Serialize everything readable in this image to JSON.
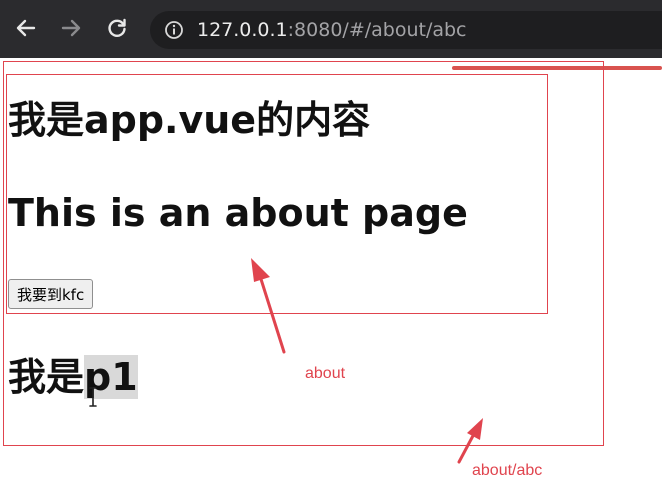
{
  "browser": {
    "url_host": "127.0.0.1",
    "url_rest": ":8080/#/about/abc"
  },
  "page": {
    "app_heading": "我是app.vue的内容",
    "about_heading": "This is an about page",
    "kfc_button_label": "我要到kfc",
    "p1_prefix": "我是",
    "p1_highlight": "p1"
  },
  "annotations": {
    "inner_label": "about",
    "outer_label": "about/abc",
    "color": "#e0444e"
  },
  "icons": [
    "back-arrow-icon",
    "forward-arrow-icon",
    "reload-icon",
    "info-icon",
    "text-cursor-icon",
    "annotation-arrow-icon"
  ]
}
